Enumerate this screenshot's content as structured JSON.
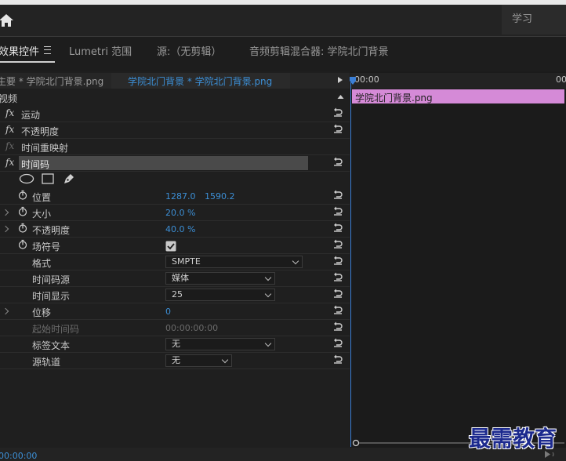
{
  "workspace": "学习",
  "tabs": [
    {
      "label": "效果控件",
      "active": true
    },
    {
      "label": "Lumetri 范围",
      "active": false
    },
    {
      "label": "源:（无剪辑）",
      "active": false
    },
    {
      "label": "音频剪辑混合器: 学院北门背景",
      "active": false
    }
  ],
  "clip": {
    "master": "主要 * 学院北门背景.png",
    "sequence": "学院北门背景 * 学院北门背景.png"
  },
  "section": "视频",
  "effects": [
    {
      "label": "运动"
    },
    {
      "label": "不透明度"
    },
    {
      "label": "时间重映射"
    },
    {
      "label": "时间码"
    }
  ],
  "properties": {
    "position": {
      "label": "位置",
      "x": "1287.0",
      "y": "1590.2"
    },
    "scale": {
      "label": "大小",
      "value": "20.0 %"
    },
    "opacity": {
      "label": "不透明度",
      "value": "40.0 %"
    },
    "field_symbol": {
      "label": "场符号",
      "checked": true
    },
    "format": {
      "label": "格式",
      "value": "SMPTE"
    },
    "tc_source": {
      "label": "时间码源",
      "value": "媒体"
    },
    "tc_display": {
      "label": "时间显示",
      "value": "25"
    },
    "offset": {
      "label": "位移",
      "value": "0"
    },
    "start_tc": {
      "label": "起始时间码",
      "value": "00:00:00:00"
    },
    "label_text": {
      "label": "标签文本",
      "value": "无"
    },
    "source_track": {
      "label": "源轨道",
      "value": "无"
    }
  },
  "timeline": {
    "ruler_start": "00:00",
    "ruler_end": "00",
    "clip_name": "学院北门背景.png"
  },
  "bottom": {
    "timecode": "00:00:00"
  },
  "watermark": "最需教育",
  "colors": {
    "accent": "#3c8fd6",
    "clip": "#d58ad7",
    "panel": "#1f1f1f"
  }
}
